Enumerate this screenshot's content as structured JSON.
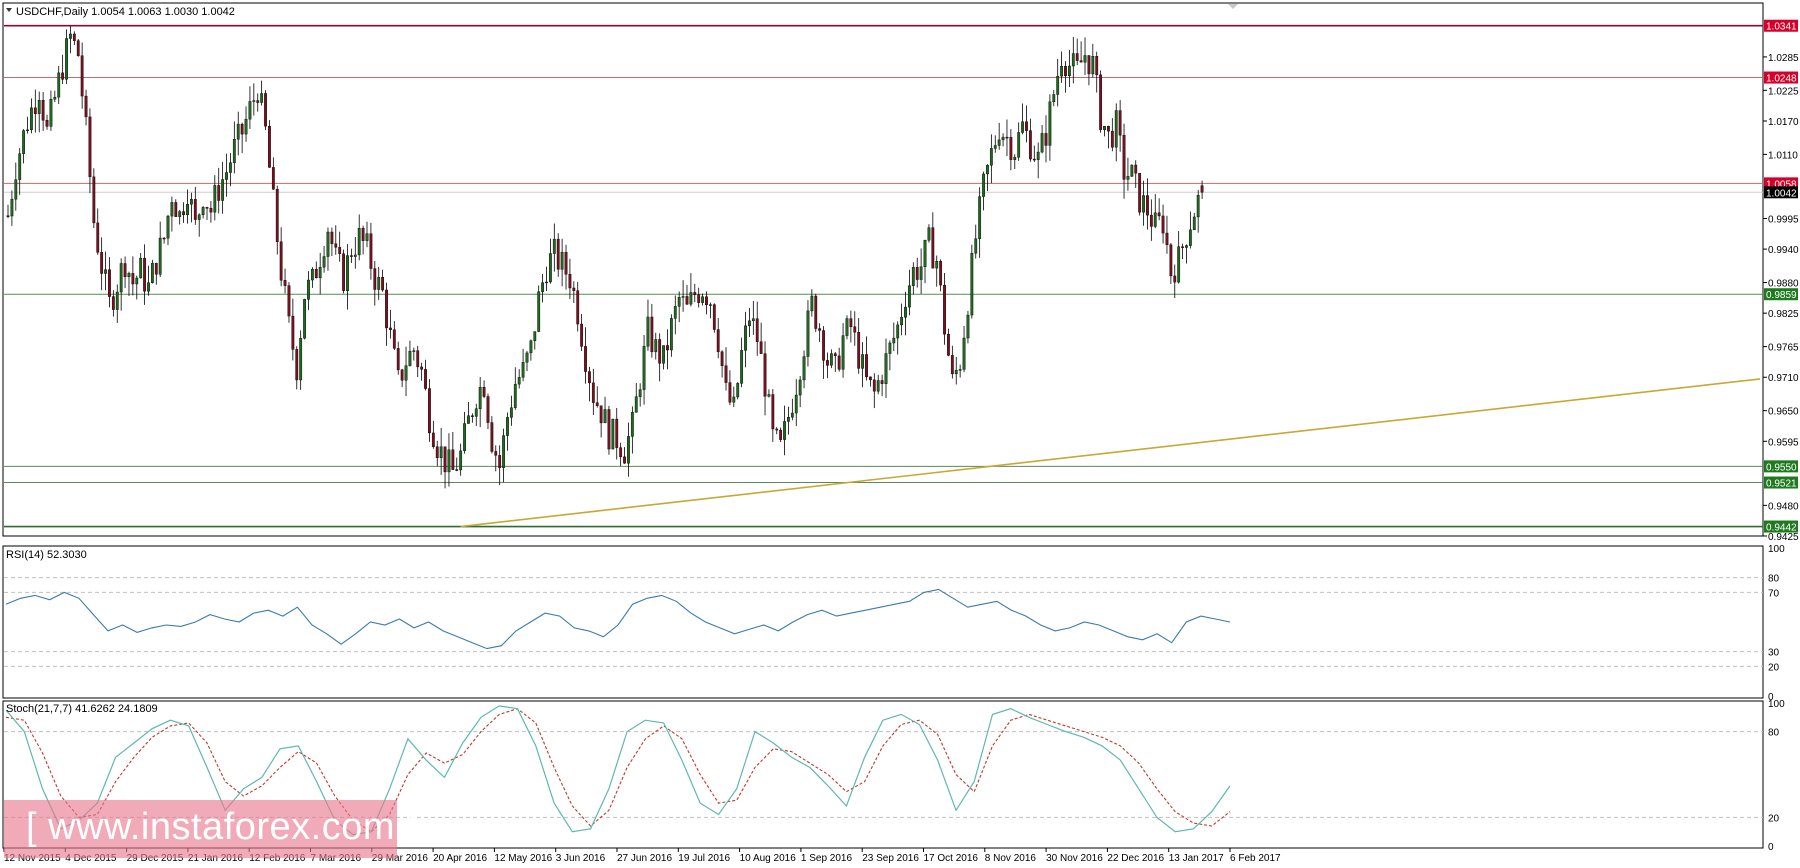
{
  "header": {
    "symbol_title": "USDCHF,Daily  1.0054 1.0063 1.0030 1.0042"
  },
  "chart_data": {
    "type": "candlestick",
    "symbol": "USDCHF",
    "timeframe": "Daily",
    "last_ohlc": {
      "open": 1.0054,
      "high": 1.0063,
      "low": 1.003,
      "close": 1.0042
    },
    "price_axis_ticks": [
      "1.0341",
      "1.0285",
      "1.0225",
      "1.0170",
      "1.0110",
      "1.0058",
      "1.0042",
      "0.9995",
      "0.9940",
      "0.9880",
      "0.9859",
      "0.9825",
      "0.9765",
      "0.9710",
      "0.9650",
      "0.9595",
      "0.9550",
      "0.9521",
      "0.9480",
      "0.9442",
      "0.9425"
    ],
    "date_labels": [
      "12 Nov 2015",
      "4 Dec 2015",
      "29 Dec 2015",
      "21 Jan 2016",
      "12 Feb 2016",
      "7 Mar 2016",
      "29 Mar 2016",
      "20 Apr 2016",
      "12 May 2016",
      "3 Jun 2016",
      "27 Jun 2016",
      "19 Jul 2016",
      "10 Aug 2016",
      "1 Sep 2016",
      "23 Sep 2016",
      "17 Oct 2016",
      "8 Nov 2016",
      "30 Nov 2016",
      "22 Dec 2016",
      "13 Jan 2017",
      "6 Feb 2017"
    ],
    "ylim": [
      0.9425,
      1.038
    ],
    "price_path": [
      [
        0,
        1.0
      ],
      [
        2,
        1.009
      ],
      [
        5,
        1.017
      ],
      [
        8,
        1.023
      ],
      [
        10,
        1.015
      ],
      [
        12,
        1.021
      ],
      [
        14,
        1.027
      ],
      [
        16,
        1.032
      ],
      [
        18,
        1.029
      ],
      [
        20,
        1.015
      ],
      [
        22,
        0.999
      ],
      [
        24,
        0.991
      ],
      [
        26,
        0.984
      ],
      [
        28,
        0.988
      ],
      [
        30,
        0.992
      ],
      [
        32,
        0.988
      ],
      [
        34,
        0.99
      ],
      [
        36,
        0.987
      ],
      [
        38,
        0.992
      ],
      [
        40,
        0.996
      ],
      [
        42,
        1.004
      ],
      [
        44,
        1.0
      ],
      [
        46,
        1.005
      ],
      [
        48,
        0.998
      ],
      [
        50,
        1.004
      ],
      [
        52,
        1.001
      ],
      [
        54,
        1.005
      ],
      [
        56,
        1.008
      ],
      [
        58,
        1.012
      ],
      [
        60,
        1.015
      ],
      [
        62,
        1.019
      ],
      [
        64,
        1.023
      ],
      [
        66,
        1.015
      ],
      [
        68,
        1.002
      ],
      [
        70,
        0.99
      ],
      [
        72,
        0.98
      ],
      [
        74,
        0.973
      ],
      [
        76,
        0.986
      ],
      [
        78,
        0.988
      ],
      [
        80,
        0.993
      ],
      [
        82,
        0.998
      ],
      [
        84,
        0.992
      ],
      [
        86,
        0.989
      ],
      [
        88,
        0.994
      ],
      [
        90,
        0.996
      ],
      [
        92,
        0.994
      ],
      [
        94,
        0.989
      ],
      [
        96,
        0.986
      ],
      [
        98,
        0.978
      ],
      [
        100,
        0.97
      ],
      [
        102,
        0.974
      ],
      [
        104,
        0.976
      ],
      [
        106,
        0.972
      ],
      [
        108,
        0.964
      ],
      [
        110,
        0.959
      ],
      [
        112,
        0.956
      ],
      [
        114,
        0.954
      ],
      [
        116,
        0.957
      ],
      [
        118,
        0.963
      ],
      [
        120,
        0.968
      ],
      [
        122,
        0.97
      ],
      [
        124,
        0.96
      ],
      [
        126,
        0.955
      ],
      [
        128,
        0.964
      ],
      [
        130,
        0.97
      ],
      [
        132,
        0.972
      ],
      [
        134,
        0.976
      ],
      [
        136,
        0.985
      ],
      [
        138,
        0.991
      ],
      [
        140,
        0.993
      ],
      [
        142,
        0.991
      ],
      [
        144,
        0.989
      ],
      [
        146,
        0.983
      ],
      [
        148,
        0.975
      ],
      [
        150,
        0.968
      ],
      [
        152,
        0.965
      ],
      [
        154,
        0.961
      ],
      [
        156,
        0.96
      ],
      [
        158,
        0.958
      ],
      [
        160,
        0.962
      ],
      [
        162,
        0.971
      ],
      [
        164,
        0.979
      ],
      [
        166,
        0.976
      ],
      [
        168,
        0.974
      ],
      [
        170,
        0.98
      ],
      [
        172,
        0.985
      ],
      [
        174,
        0.983
      ],
      [
        176,
        0.986
      ],
      [
        178,
        0.987
      ],
      [
        180,
        0.985
      ],
      [
        182,
        0.978
      ],
      [
        184,
        0.968
      ],
      [
        186,
        0.965
      ],
      [
        188,
        0.975
      ],
      [
        190,
        0.982
      ],
      [
        192,
        0.978
      ],
      [
        194,
        0.97
      ],
      [
        196,
        0.96
      ],
      [
        198,
        0.958
      ],
      [
        200,
        0.964
      ],
      [
        202,
        0.97
      ],
      [
        204,
        0.977
      ],
      [
        206,
        0.984
      ],
      [
        208,
        0.98
      ],
      [
        210,
        0.974
      ],
      [
        212,
        0.972
      ],
      [
        214,
        0.978
      ],
      [
        216,
        0.98
      ],
      [
        218,
        0.975
      ],
      [
        220,
        0.97
      ],
      [
        222,
        0.968
      ],
      [
        224,
        0.972
      ],
      [
        226,
        0.976
      ],
      [
        228,
        0.98
      ],
      [
        230,
        0.986
      ],
      [
        232,
        0.99
      ],
      [
        234,
        0.991
      ],
      [
        236,
        0.995
      ],
      [
        238,
        0.992
      ],
      [
        240,
        0.98
      ],
      [
        242,
        0.97
      ],
      [
        244,
        0.974
      ],
      [
        246,
        0.985
      ],
      [
        248,
        0.996
      ],
      [
        250,
        1.005
      ],
      [
        252,
        1.011
      ],
      [
        254,
        1.016
      ],
      [
        256,
        1.014
      ],
      [
        258,
        1.012
      ],
      [
        260,
        1.016
      ],
      [
        262,
        1.013
      ],
      [
        264,
        1.01
      ],
      [
        266,
        1.015
      ],
      [
        268,
        1.022
      ],
      [
        270,
        1.029
      ],
      [
        272,
        1.027
      ],
      [
        274,
        1.026
      ],
      [
        276,
        1.029
      ],
      [
        278,
        1.027
      ],
      [
        280,
        1.018
      ],
      [
        282,
        1.014
      ],
      [
        284,
        1.016
      ],
      [
        286,
        1.008
      ],
      [
        288,
        1.007
      ],
      [
        290,
        1.003
      ],
      [
        292,
        1.001
      ],
      [
        294,
        0.998
      ],
      [
        296,
        0.999
      ],
      [
        298,
        0.99
      ],
      [
        300,
        0.992
      ],
      [
        302,
        0.997
      ],
      [
        304,
        1.001
      ],
      [
        306,
        1.0042
      ]
    ],
    "horizontal_lines": [
      {
        "price": 1.0341,
        "label": "1.0341",
        "color": "#8b0a32",
        "label_bg": "#d4002a"
      },
      {
        "price": 1.0248,
        "label": "1.0248",
        "color": "#b8706a",
        "label_bg": "#d4002a"
      },
      {
        "price": 1.0058,
        "label": "1.0058",
        "color": "#b8706a",
        "label_bg": "#d4002a"
      },
      {
        "price": 1.0042,
        "label": "1.0042",
        "color": "#c8d0d0",
        "label_bg": "#000000"
      },
      {
        "price": 0.9859,
        "label": "0.9859",
        "color": "#5a8a5a",
        "label_bg": "#1f7a1f"
      },
      {
        "price": 0.955,
        "label": "0.9550",
        "color": "#5a8a5a",
        "label_bg": "#1f7a1f"
      },
      {
        "price": 0.9521,
        "label": "0.9521",
        "color": "#5a8a5a",
        "label_bg": "#1f7a1f"
      },
      {
        "price": 0.9442,
        "label": "0.9442",
        "color": "#2f6a2f",
        "label_bg": "#1f7a1f"
      }
    ],
    "trendline": {
      "from": {
        "bar": 116,
        "price": 0.9442
      },
      "to": {
        "bar": 449,
        "price": 0.9707
      },
      "color": "#c8a832"
    },
    "rsi": {
      "title": "RSI(14) 52.3030",
      "levels": [
        "100",
        "80",
        "70",
        "30",
        "20",
        "0"
      ],
      "level_lines": [
        80,
        70,
        30,
        20
      ],
      "values": [
        62,
        66,
        68,
        65,
        70,
        66,
        55,
        44,
        48,
        43,
        46,
        48,
        47,
        50,
        55,
        52,
        50,
        56,
        58,
        54,
        60,
        48,
        42,
        35,
        42,
        50,
        48,
        52,
        46,
        50,
        44,
        40,
        36,
        32,
        34,
        44,
        50,
        56,
        54,
        46,
        44,
        40,
        48,
        62,
        66,
        68,
        64,
        56,
        50,
        46,
        42,
        45,
        48,
        44,
        50,
        55,
        58,
        54,
        56,
        58,
        60,
        62,
        64,
        70,
        72,
        66,
        60,
        62,
        64,
        58,
        54,
        48,
        44,
        46,
        50,
        48,
        44,
        40,
        38,
        42,
        36,
        50,
        54,
        52,
        50
      ]
    },
    "stochastic": {
      "title": "Stoch(21,7,7) 41.6262 24.1809",
      "levels": [
        "100",
        "80",
        "20",
        "0"
      ],
      "level_lines": [
        80,
        20
      ],
      "main": [
        95,
        80,
        40,
        12,
        18,
        30,
        62,
        72,
        82,
        88,
        84,
        55,
        25,
        40,
        48,
        68,
        70,
        45,
        18,
        8,
        10,
        40,
        75,
        60,
        48,
        72,
        90,
        98,
        96,
        70,
        30,
        10,
        12,
        40,
        80,
        88,
        86,
        60,
        30,
        22,
        40,
        80,
        72,
        62,
        55,
        42,
        28,
        62,
        88,
        92,
        85,
        60,
        25,
        45,
        92,
        96,
        90,
        85,
        80,
        76,
        70,
        60,
        40,
        20,
        10,
        12,
        24,
        42
      ],
      "signal": [
        90,
        88,
        65,
        35,
        20,
        22,
        45,
        62,
        76,
        84,
        86,
        72,
        45,
        35,
        42,
        55,
        66,
        58,
        35,
        18,
        10,
        22,
        50,
        65,
        58,
        64,
        80,
        92,
        96,
        86,
        55,
        28,
        14,
        25,
        55,
        75,
        84,
        75,
        50,
        30,
        32,
        55,
        68,
        66,
        58,
        50,
        38,
        45,
        70,
        85,
        88,
        78,
        50,
        38,
        70,
        88,
        92,
        88,
        84,
        80,
        76,
        70,
        58,
        40,
        24,
        16,
        14,
        24
      ]
    },
    "watermark_text": "[ www.instaforex.com ]"
  }
}
